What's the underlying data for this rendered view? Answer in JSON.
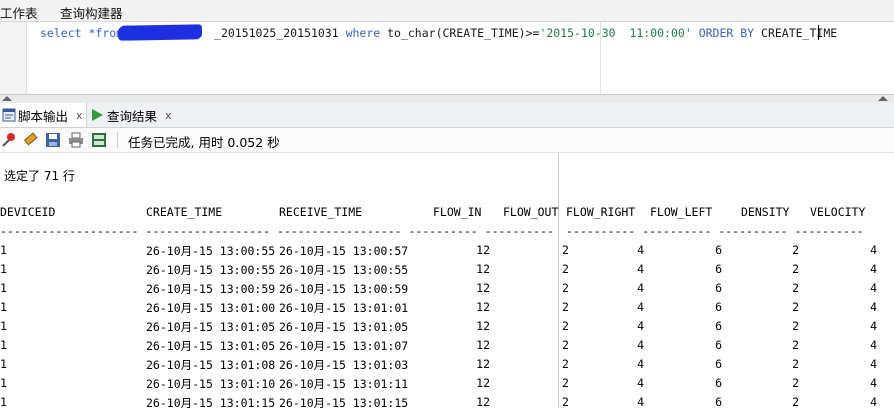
{
  "top_tabs": [
    "工作表",
    "查询构建器"
  ],
  "editor": {
    "sql": {
      "select": "select",
      "star_from": " *from ",
      "table_suffix": "_20151025_20151031",
      "where": " where ",
      "func": "to_char(CREATE_TIME)>=",
      "literal": "'2015-10-30  11:00:00'",
      "order_by": " ORDER BY ",
      "col": "CREATE_TIME"
    }
  },
  "output_tabs": [
    {
      "label": "脚本输出",
      "close": "x"
    },
    {
      "label": "查询结果",
      "close": "x"
    }
  ],
  "toolbar": {
    "icons": [
      "pin-icon",
      "eraser-icon",
      "save-icon",
      "print-icon",
      "export-icon"
    ],
    "status": "任务已完成, 用时 0.052 秒"
  },
  "result": {
    "summary": "选定了 71 行",
    "columns": [
      "DEVICEID",
      "CREATE_TIME",
      "RECEIVE_TIME",
      "FLOW_IN",
      "FLOW_OUT",
      "FLOW_RIGHT",
      "FLOW_LEFT",
      "DENSITY",
      "VELOCITY"
    ],
    "separator_left": "-------------------- ------------------ ------------------ ---------- ----------",
    "separator_right": "---------- ---------- ---------- ----------",
    "rows": [
      [
        "1",
        "26-10月-15 13:00:55",
        "26-10月-15 13:00:57",
        "12",
        "",
        "2",
        "4",
        "6",
        "2",
        "4"
      ],
      [
        "1",
        "26-10月-15 13:00:55",
        "26-10月-15 13:00:55",
        "12",
        "",
        "2",
        "4",
        "6",
        "2",
        "4"
      ],
      [
        "1",
        "26-10月-15 13:00:59",
        "26-10月-15 13:00:59",
        "12",
        "",
        "2",
        "4",
        "6",
        "2",
        "4"
      ],
      [
        "1",
        "26-10月-15 13:01:00",
        "26-10月-15 13:01:01",
        "12",
        "",
        "2",
        "4",
        "6",
        "2",
        "4"
      ],
      [
        "1",
        "26-10月-15 13:01:05",
        "26-10月-15 13:01:05",
        "12",
        "",
        "2",
        "4",
        "6",
        "2",
        "4"
      ],
      [
        "1",
        "26-10月-15 13:01:05",
        "26-10月-15 13:01:07",
        "12",
        "",
        "2",
        "4",
        "6",
        "2",
        "4"
      ],
      [
        "1",
        "26-10月-15 13:01:08",
        "26-10月-15 13:01:03",
        "12",
        "",
        "2",
        "4",
        "6",
        "2",
        "4"
      ],
      [
        "1",
        "26-10月-15 13:01:10",
        "26-10月-15 13:01:11",
        "12",
        "",
        "2",
        "4",
        "6",
        "2",
        "4"
      ],
      [
        "1",
        "26-10月-15 13:01:15",
        "26-10月-15 13:01:15",
        "12",
        "",
        "2",
        "4",
        "6",
        "2",
        "4"
      ]
    ]
  },
  "colors": {
    "accent": "#3a5fbd",
    "string": "#1f7a4b",
    "redaction": "#1d2fe0"
  }
}
